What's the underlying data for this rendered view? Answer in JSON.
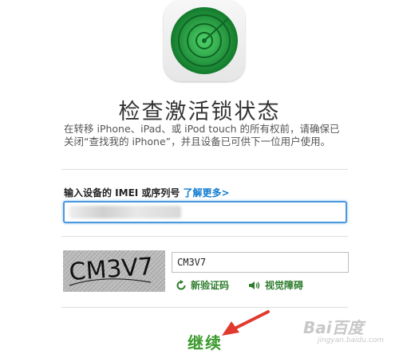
{
  "title": "检查激活锁状态",
  "description_line1": "在转移 iPhone、iPad、或 iPod touch 的所有权前，请确保已",
  "description_line2": "关闭“查找我的 iPhone”，并且设备已可供下一位用户使用。",
  "imei": {
    "label": "输入设备的 IMEI 或序列号",
    "learn_more": "了解更多>",
    "value": ""
  },
  "captcha": {
    "image_text": "CM3V7",
    "input_value": "CM3V7",
    "refresh_label": "新验证码",
    "audio_label": "视觉障碍"
  },
  "continue_label": "继续",
  "watermark": {
    "main": "Bai百度",
    "sub": "jingyan.baidu.com"
  },
  "colors": {
    "accent_blue": "#0f7bd0",
    "link_green": "#2e7d2e",
    "continue_green": "#3c9a2d",
    "radar_green": "#1e9e3a"
  },
  "icons": {
    "app": "find-my-iphone-radar-icon",
    "refresh": "refresh-icon",
    "audio": "speaker-icon",
    "annotation": "red-arrow-icon"
  }
}
